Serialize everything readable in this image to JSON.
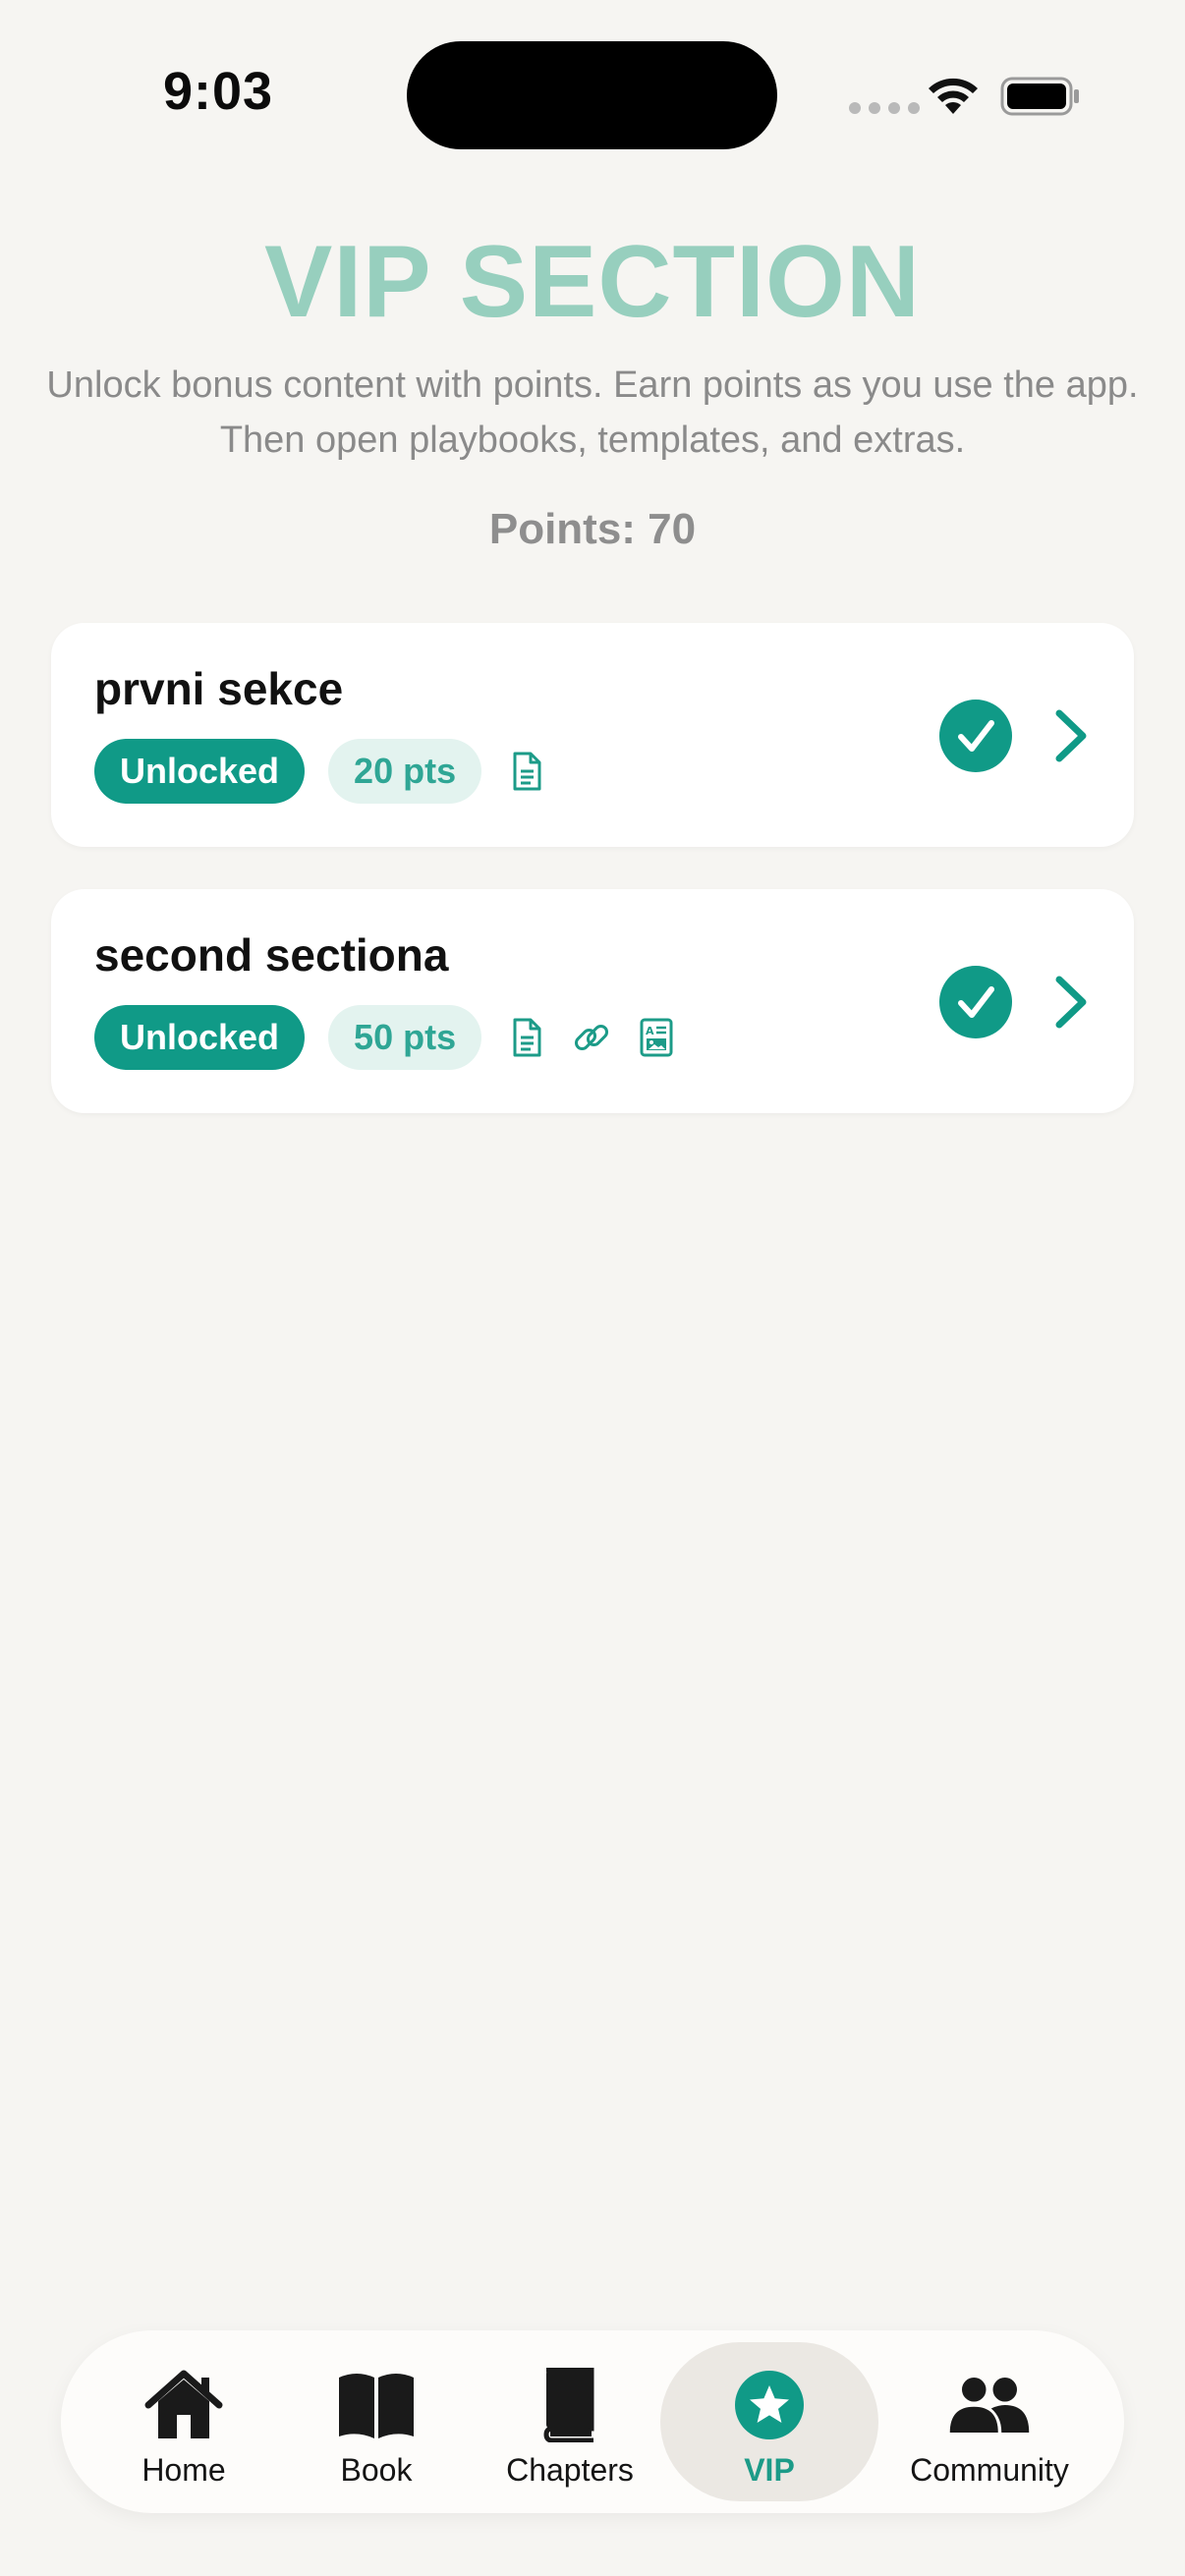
{
  "status_bar": {
    "time": "9:03"
  },
  "header": {
    "title": "VIP SECTION",
    "subtitle": "Unlock bonus content with points. Earn points as you use the app. Then open playbooks, templates, and extras.",
    "points": "Points: 70"
  },
  "sections": [
    {
      "title": "prvni sekce",
      "status": "Unlocked",
      "cost": "20 pts",
      "content_icons": [
        "document-icon"
      ]
    },
    {
      "title": "second sectiona",
      "status": "Unlocked",
      "cost": "50 pts",
      "content_icons": [
        "document-icon",
        "link-icon",
        "template-icon"
      ]
    }
  ],
  "tab_bar": {
    "items": [
      {
        "label": "Home",
        "icon": "house-icon",
        "active": false
      },
      {
        "label": "Book",
        "icon": "open-book-icon",
        "active": false
      },
      {
        "label": "Chapters",
        "icon": "closed-book-icon",
        "active": false
      },
      {
        "label": "VIP",
        "icon": "star-circle-icon",
        "active": true
      },
      {
        "label": "Community",
        "icon": "people-icon",
        "active": false
      }
    ]
  },
  "colors": {
    "accent": "#109a87",
    "title": "#97cfbe",
    "background": "#f6f5f2",
    "card": "#ffffff",
    "points_badge_bg": "#e3f3ef"
  }
}
